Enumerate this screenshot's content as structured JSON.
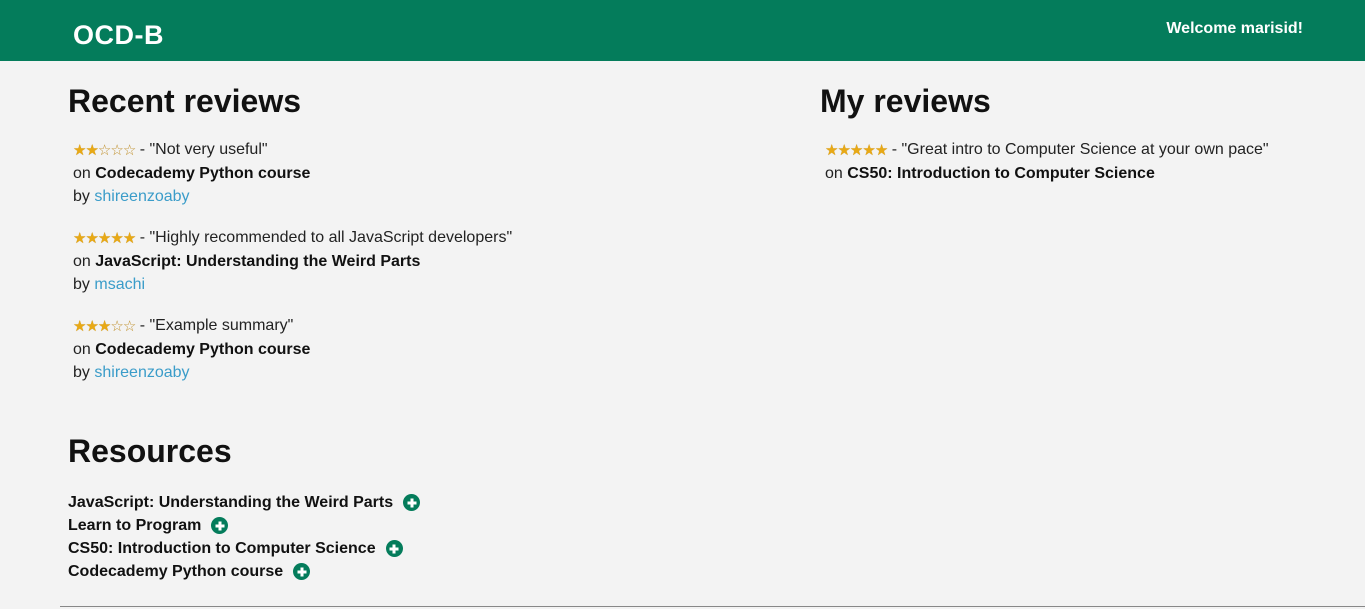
{
  "header": {
    "brand": "OCD-B",
    "welcome": "Welcome marisid!",
    "color": "#047c5b"
  },
  "recent_reviews": {
    "title": "Recent reviews",
    "items": [
      {
        "rating": 2,
        "max_rating": 5,
        "summary": "- \"Not very useful\"",
        "on_prefix": "on",
        "course": "Codecademy Python course",
        "by_prefix": "by",
        "author": "shireenzoaby"
      },
      {
        "rating": 5,
        "max_rating": 5,
        "summary": "- \"Highly recommended to all JavaScript developers\"",
        "on_prefix": "on",
        "course": "JavaScript: Understanding the Weird Parts",
        "by_prefix": "by",
        "author": "msachi"
      },
      {
        "rating": 3,
        "max_rating": 5,
        "summary": "- \"Example summary\"",
        "on_prefix": "on",
        "course": "Codecademy Python course",
        "by_prefix": "by",
        "author": "shireenzoaby"
      }
    ]
  },
  "my_reviews": {
    "title": "My reviews",
    "items": [
      {
        "rating": 5,
        "max_rating": 5,
        "summary": "- \"Great intro to Computer Science at your own pace\"",
        "on_prefix": "on",
        "course": "CS50: Introduction to Computer Science"
      }
    ]
  },
  "resources": {
    "title": "Resources",
    "items": [
      {
        "label": "JavaScript: Understanding the Weird Parts",
        "icon": "plus-circle-icon"
      },
      {
        "label": "Learn to Program",
        "icon": "plus-circle-icon"
      },
      {
        "label": "CS50: Introduction to Computer Science",
        "icon": "plus-circle-icon"
      },
      {
        "label": "Codecademy Python course",
        "icon": "plus-circle-icon"
      }
    ]
  },
  "colors": {
    "star": "#e8a915",
    "link": "#3a9cc9",
    "background": "#f3f3f3"
  }
}
